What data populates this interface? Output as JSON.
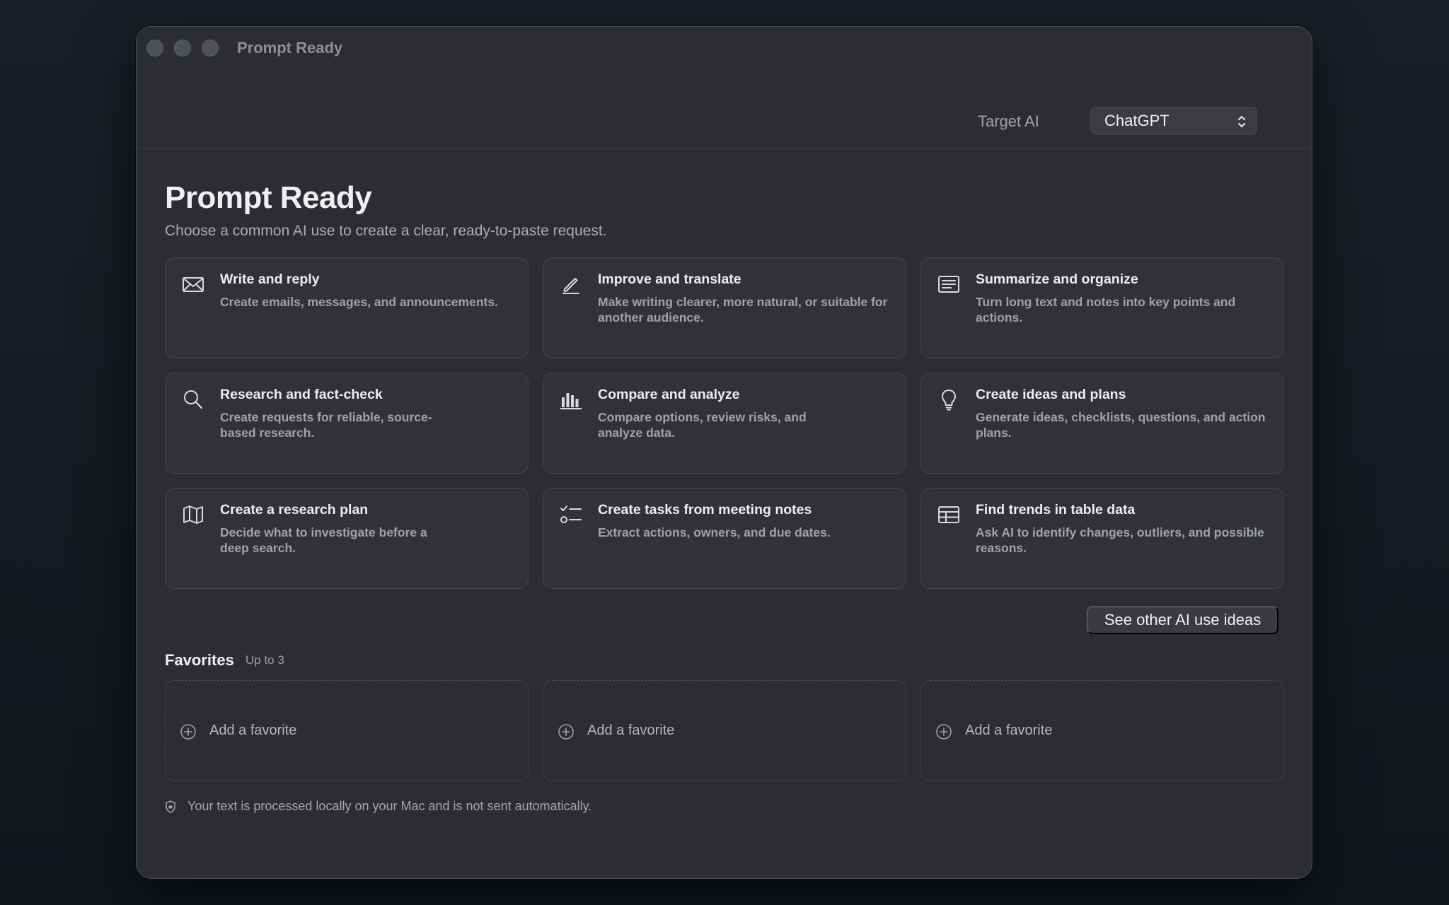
{
  "window": {
    "title": "Prompt Ready"
  },
  "toolbar": {
    "target_label": "Target AI",
    "target_value": "ChatGPT"
  },
  "main": {
    "title": "Prompt Ready",
    "subtitle": "Choose a common AI use to create a clear, ready-to-paste request.",
    "cards": [
      {
        "icon": "envelope-icon",
        "title": "Write and reply",
        "desc": "Create emails, messages, and announcements."
      },
      {
        "icon": "pencil-icon",
        "title": "Improve and translate",
        "desc": "Make writing clearer, more natural, or suitable for another audience."
      },
      {
        "icon": "text-list-icon",
        "title": "Summarize and organize",
        "desc": "Turn long text and notes into key points and actions."
      },
      {
        "icon": "magnifier-icon",
        "title": "Research and fact-check",
        "desc": "Create requests for reliable, source-based research."
      },
      {
        "icon": "bar-chart-icon",
        "title": "Compare and analyze",
        "desc": "Compare options, review risks, and analyze data."
      },
      {
        "icon": "lightbulb-icon",
        "title": "Create ideas and plans",
        "desc": "Generate ideas, checklists, questions, and action plans."
      },
      {
        "icon": "map-icon",
        "title": "Create a research plan",
        "desc": "Decide what to investigate before a deep search."
      },
      {
        "icon": "checklist-icon",
        "title": "Create tasks from meeting notes",
        "desc": "Extract actions, owners, and due dates."
      },
      {
        "icon": "table-icon",
        "title": "Find trends in table data",
        "desc": "Ask AI to identify changes, outliers, and possible reasons."
      }
    ],
    "see_other_label": "See other AI use ideas"
  },
  "favorites": {
    "title": "Favorites",
    "subtitle": "Up to 3",
    "slots": [
      {
        "label": "Add a favorite"
      },
      {
        "label": "Add a favorite"
      },
      {
        "label": "Add a favorite"
      }
    ]
  },
  "footer": {
    "privacy_text": "Your text is processed locally on your Mac and is not sent automatically."
  }
}
